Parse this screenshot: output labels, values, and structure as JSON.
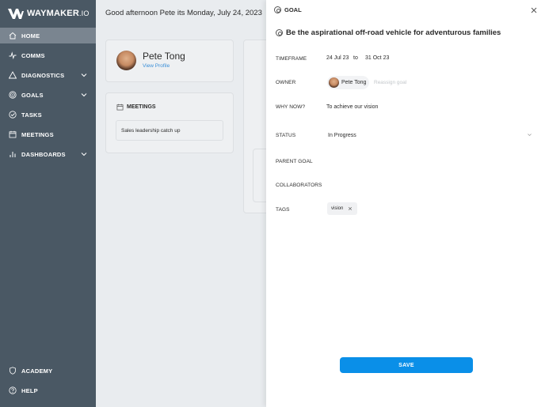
{
  "brand": {
    "name": "WAYMAKER",
    "suffix": ".IO"
  },
  "sidebar": {
    "items": [
      {
        "label": "HOME",
        "icon": "home-icon",
        "active": true
      },
      {
        "label": "COMMS",
        "icon": "pulse-icon"
      },
      {
        "label": "DIAGNOSTICS",
        "icon": "triangle-icon",
        "expandable": true
      },
      {
        "label": "GOALS",
        "icon": "target-icon",
        "expandable": true
      },
      {
        "label": "TASKS",
        "icon": "check-circle-icon"
      },
      {
        "label": "MEETINGS",
        "icon": "calendar-icon"
      },
      {
        "label": "DASHBOARDS",
        "icon": "bar-chart-icon",
        "expandable": true
      }
    ],
    "bottom": [
      {
        "label": "ACADEMY",
        "icon": "shield-icon"
      },
      {
        "label": "HELP",
        "icon": "help-icon"
      }
    ]
  },
  "main": {
    "greeting": "Good afternoon Pete its Monday, July 24, 2023",
    "profile": {
      "name": "Pete Tong",
      "link": "View Profile"
    },
    "meetings": {
      "title": "MEETINGS",
      "items": [
        "Sales leadership catch up"
      ]
    }
  },
  "panel": {
    "header": "GOAL",
    "goal_title": "Be the aspirational off-road vehicle for adventurous families",
    "fields": {
      "timeframe_label": "TIMEFRAME",
      "timeframe_start": "24 Jul 23",
      "timeframe_to": "to",
      "timeframe_end": "31 Oct 23",
      "owner_label": "OWNER",
      "owner_name": "Pete Tong",
      "reassign": "Reassign goal",
      "why_label": "WHY NOW?",
      "why_value": "To achieve our vision",
      "status_label": "STATUS",
      "status_value": "In Progress",
      "parent_label": "PARENT GOAL",
      "collab_label": "COLLABORATORS",
      "tags_label": "TAGS",
      "tags": [
        "vision"
      ]
    },
    "save_label": "SAVE"
  },
  "colors": {
    "sidebar": "#4a5864",
    "sidebar_active": "#7a8590",
    "primary": "#0a8fe8",
    "link": "#3a8fd8"
  }
}
